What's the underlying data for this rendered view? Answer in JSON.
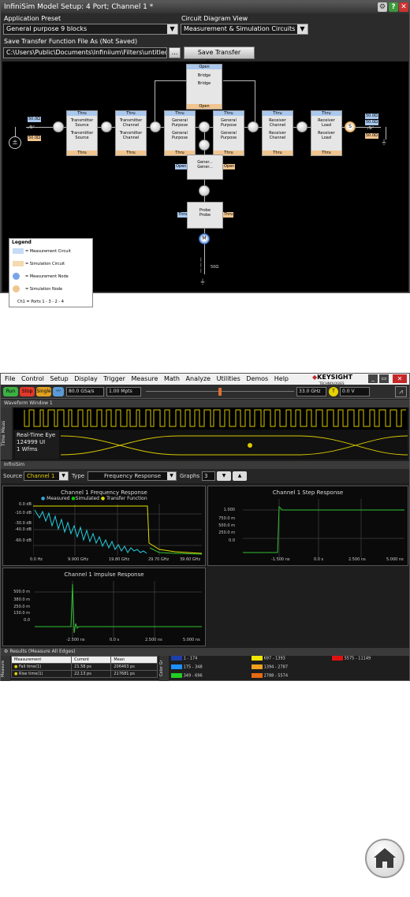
{
  "model_window": {
    "title": "InfiniSim Model Setup: 4 Port; Channel 1 *",
    "preset_label": "Application Preset",
    "preset_value": "General purpose 9 blocks",
    "circuit_label": "Circuit Diagram View",
    "circuit_value": "Measurement & Simulation Circuits",
    "save_label": "Save Transfer Function File As (Not Saved)",
    "save_path": "C:\\Users\\Public\\Documents\\Infiniium\\Filters\\untitled.tf4",
    "browse_button": "...",
    "save_button": "Save Transfer Function",
    "blocks": [
      {
        "top": "Thru",
        "l1": "Transmitter",
        "l2": "Source",
        "l3": "Transmitter",
        "l4": "Source",
        "bottom": "Thru"
      },
      {
        "top": "Thru",
        "l1": "Transmitter",
        "l2": "Channel",
        "l3": "Transmitter",
        "l4": "Channel",
        "bottom": "Thru"
      },
      {
        "top": "Thru",
        "l1": "General",
        "l2": "Purpose",
        "l3": "General",
        "l4": "Purpose",
        "bottom": "Thru"
      },
      {
        "top": "Thru",
        "l1": "General",
        "l2": "Purpose",
        "l3": "General",
        "l4": "Purpose",
        "bottom": "Thru"
      },
      {
        "top": "Thru",
        "l1": "Receiver",
        "l2": "Channel",
        "l3": "Receiver",
        "l4": "Channel",
        "bottom": "Thru"
      },
      {
        "top": "Thru",
        "l1": "Receiver",
        "l2": "Load",
        "l3": "Receiver",
        "l4": "Load",
        "bottom": "Thru"
      }
    ],
    "bridge": {
      "top": "Open",
      "l1": "Bridge",
      "l2": "Bridge",
      "bottom": "Open"
    },
    "general": {
      "left": "Open",
      "l1": "Gener...",
      "l2": "Gener...",
      "right": "Open"
    },
    "probe": {
      "left": "Thru",
      "l1": "Probe",
      "l2": "Probe",
      "right": "Thru"
    },
    "source_res_top": "50.0Ω",
    "source_res_bot": "50.0Ω",
    "load_res_top": "50.0Ω",
    "load_res_mid": "50.0Ω",
    "load_res_bot": "50.0Ω",
    "probe_res": "50Ω",
    "node_m": "M",
    "node_s": "S",
    "legend": {
      "title": "Legend",
      "measurement_circuit": "= Measurement Circuit",
      "simulation_circuit": "= Simulation Circuit",
      "measurement_node": "= Measurement Node",
      "simulation_node": "= Simulation Node",
      "ports": "Ch1 = Ports 1 - 3 - 2 - 4"
    }
  },
  "scope_window": {
    "menu": [
      "File",
      "Control",
      "Setup",
      "Display",
      "Trigger",
      "Measure",
      "Math",
      "Analyze",
      "Utilities",
      "Demos",
      "Help"
    ],
    "brand": "KEYSIGHT",
    "brand_sub": "TECHNOLOGIES",
    "run": "Run",
    "stop": "Stop",
    "single": "Single",
    "sample_rate": "80.0 GSa/s",
    "memory": "1.00 Mpts",
    "bandwidth": "33.0 GHz",
    "trigger_level": "0.0 V",
    "waveform_window": "Waveform Window 1",
    "eye_title": "Real-Time Eye",
    "eye_ui": "124999 UI",
    "eye_wfms": "1 Wfms",
    "side_tab_time": "Time",
    "side_tab_meas": "Meas",
    "infinisim_header": "InfiniSim",
    "source_label": "Source",
    "source_value": "Channel 1",
    "type_label": "Type",
    "type_value": "Frequency Response",
    "graphs_label": "Graphs",
    "graphs_value": "3",
    "plots": {
      "freq": {
        "title": "Channel 1 Frequency Response",
        "legend": [
          "Measured",
          "Simulated",
          "Transfer Function"
        ],
        "yticks": [
          "0.0 dB",
          "-10.0 dB",
          "-30.0 dB",
          "-40.0 dB",
          "-60.0 dB"
        ],
        "xticks": [
          "0.0 Hz",
          "9.900 GHz",
          "19.80 GHz",
          "29.70 GHz",
          "39.60 GHz"
        ]
      },
      "step": {
        "title": "Channel 1 Step Response",
        "yticks": [
          "1.000",
          "750.0 m",
          "500.0 m",
          "250.0 m",
          "0.0"
        ],
        "xticks": [
          "-1.500 ns",
          "0.0 s",
          "2.500 ns",
          "5.000 ns"
        ]
      },
      "impulse": {
        "title": "Channel 1 Impulse Response",
        "yticks": [
          "500.0 m",
          "380.0 m",
          "250.0 m",
          "130.0 m",
          "0.0"
        ],
        "xticks": [
          "-2.500 ns",
          "0.0 s",
          "2.500 ns",
          "5.000 ns"
        ]
      }
    },
    "results": {
      "header": "Results",
      "subheader": "(Measure All Edges)",
      "side_tab": "Measure",
      "columns": [
        "Measurement",
        "Current",
        "Mean"
      ],
      "rows": [
        [
          "Fall time(1)",
          "21.58 ps",
          "206463 ps"
        ],
        [
          "Rise time(1)",
          "22.13 ps",
          "217681 ps"
        ]
      ]
    },
    "color_grade": {
      "side_tab": "Color Gr",
      "bins": [
        {
          "label": "1 - 174",
          "color": "#1c3fa8"
        },
        {
          "label": "175 - 348",
          "color": "#1e90ff"
        },
        {
          "label": "349 - 696",
          "color": "#22cc22"
        },
        {
          "label": "697 - 1393",
          "color": "#f2e600"
        },
        {
          "label": "1394 - 2787",
          "color": "#f0a020"
        },
        {
          "label": "2788 - 5574",
          "color": "#e86a10"
        },
        {
          "label": "5575 - 11149",
          "color": "#e01010"
        }
      ]
    }
  }
}
